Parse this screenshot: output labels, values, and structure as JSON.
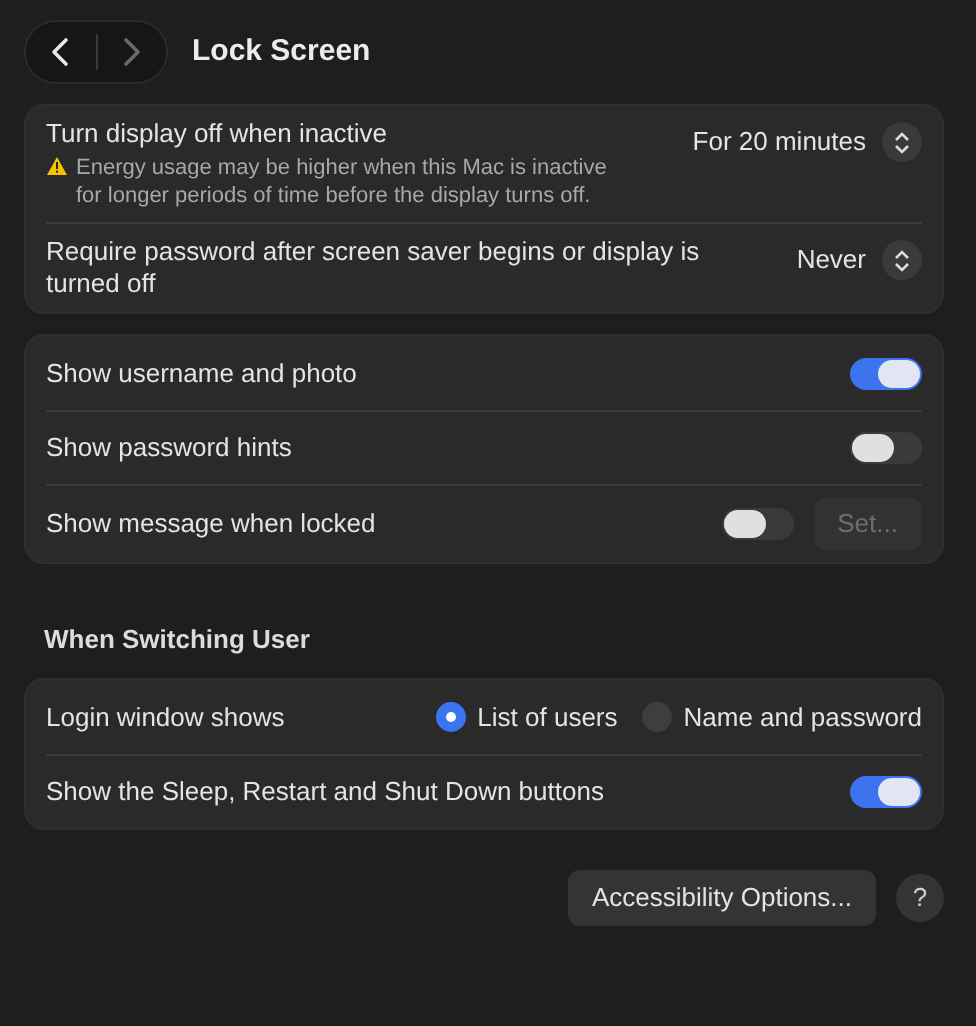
{
  "window": {
    "title": "Lock Screen",
    "nav": [
      {
        "kind": "back",
        "disabled": false
      },
      {
        "kind": "forward",
        "disabled": true
      }
    ]
  },
  "groups": [
    {
      "rows": [
        {
          "kind": "popup",
          "label": "Turn display off when inactive",
          "value": "For 20 minutes",
          "warning": "Energy usage may be higher when this Mac is inactive for longer periods of time before the display turns off."
        },
        {
          "kind": "popup",
          "label": "Require password after screen saver begins or display is turned off",
          "value": "Never"
        }
      ]
    },
    {
      "rows": [
        {
          "kind": "toggle",
          "label": "Show username and photo",
          "on": true
        },
        {
          "kind": "toggle",
          "label": "Show password hints",
          "on": false
        },
        {
          "kind": "toggle",
          "label": "Show message when locked",
          "on": false,
          "button": {
            "label": "Set...",
            "disabled": true
          }
        }
      ]
    },
    {
      "heading": "When Switching User",
      "rows": [
        {
          "kind": "radio",
          "label": "Login window shows",
          "options": [
            {
              "label": "List of users",
              "selected": true
            },
            {
              "label": "Name and password",
              "selected": false
            }
          ]
        },
        {
          "kind": "toggle",
          "label": "Show the Sleep, Restart and Shut Down buttons",
          "on": true
        }
      ]
    }
  ],
  "footer": {
    "button": "Accessibility Options...",
    "help": "?"
  }
}
